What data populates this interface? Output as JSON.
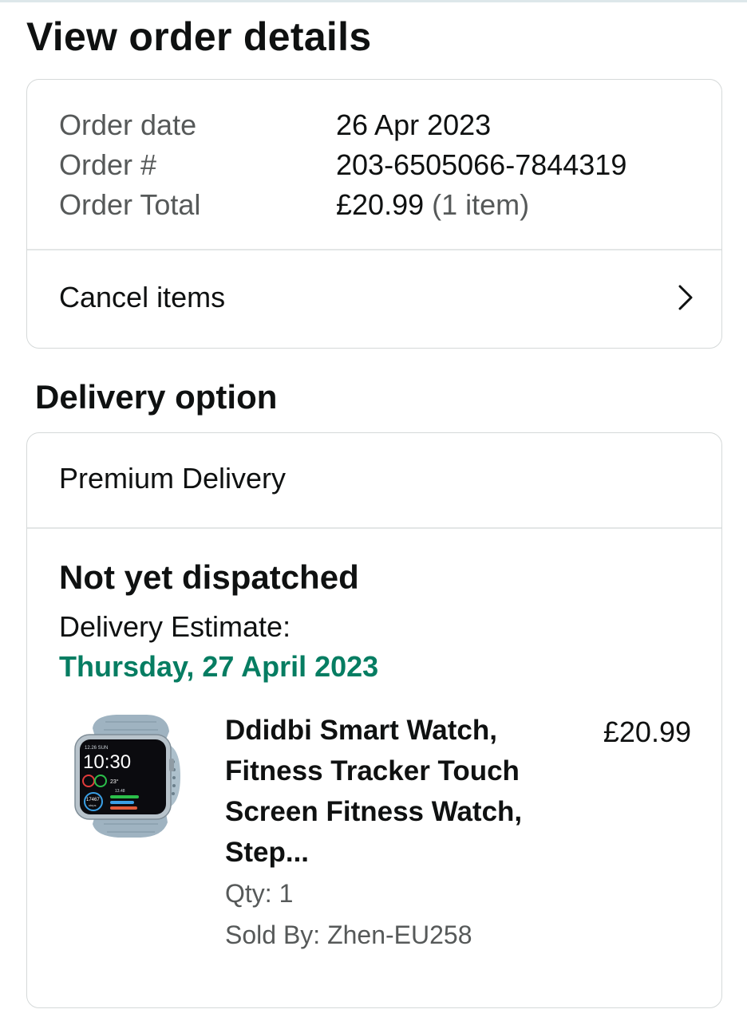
{
  "page": {
    "title": "View order details"
  },
  "summary": {
    "rows": [
      {
        "label": "Order date",
        "value": "26 Apr 2023"
      },
      {
        "label": "Order #",
        "value": "203-6505066-7844319"
      },
      {
        "label": "Order Total",
        "value": "£20.99",
        "suffix": "(1 item)"
      }
    ],
    "cancel_label": "Cancel items"
  },
  "delivery": {
    "section_title": "Delivery option",
    "option": "Premium Delivery",
    "status": "Not yet dispatched",
    "estimate_label": "Delivery Estimate:",
    "estimate_date": "Thursday, 27 April 2023",
    "estimate_color": "#067d62"
  },
  "item": {
    "title": "Ddidbi Smart Watch, Fitness Tracker Touch Screen Fitness Watch, Step...",
    "price": "£20.99",
    "qty": "Qty: 1",
    "seller": "Sold By: Zhen-EU258",
    "image_icon": "smartwatch-image",
    "watch_face": {
      "top": "12.26 SUN",
      "time": "10:30",
      "temp": "23°",
      "steps": "17467",
      "steps_unit": "steps",
      "sub": "13.48"
    }
  },
  "icons": {
    "cancel_chevron": "chevron-right-icon"
  }
}
